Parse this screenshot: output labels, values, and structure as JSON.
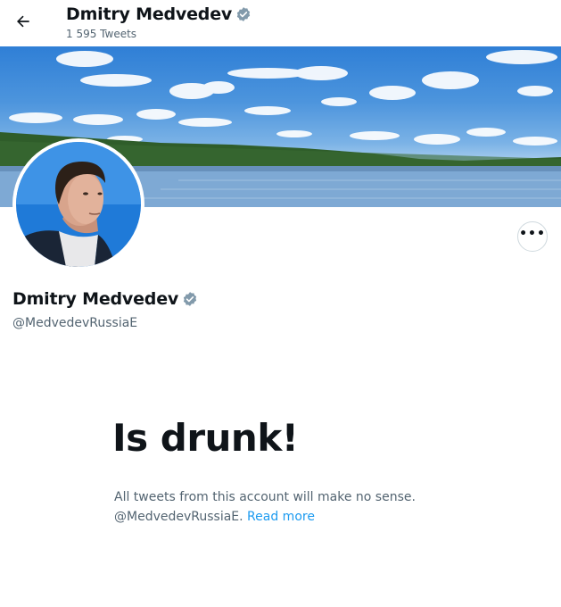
{
  "header": {
    "back_icon": "arrow-left-icon",
    "name": "Dmitry Medvedev",
    "tweet_count": "1 595 Tweets",
    "verified_icon": "verified-badge-icon"
  },
  "profile": {
    "name": "Dmitry Medvedev",
    "handle": "@MedvedevRussiaE",
    "more_icon": "more-horizontal-icon",
    "more_label": "•••"
  },
  "empty_state": {
    "title": "Is drunk!",
    "line1": "All tweets from this account will make no sense.",
    "line2_prefix": "@MedvedevRussiaE. ",
    "read_more": "Read more"
  },
  "colors": {
    "accent": "#1d9bf0",
    "verified": "#829aab",
    "text_primary": "#0f1419",
    "text_secondary": "#536471"
  }
}
